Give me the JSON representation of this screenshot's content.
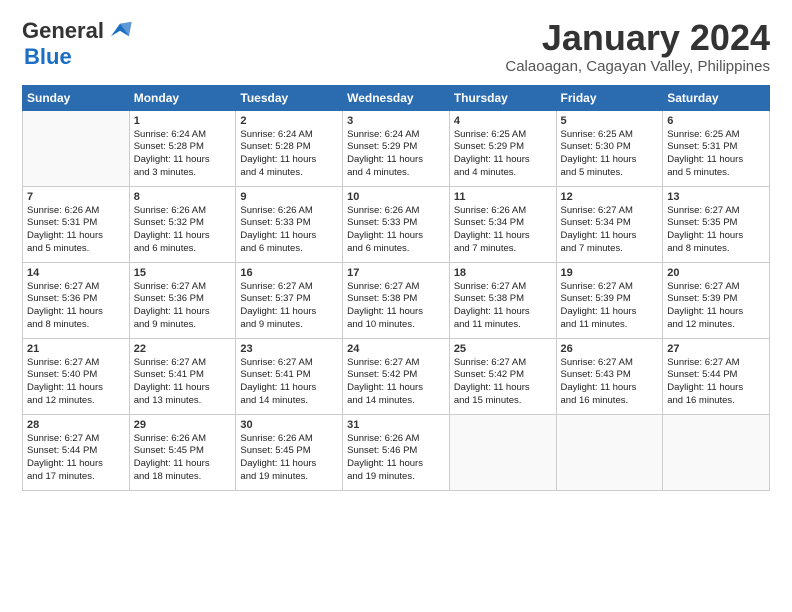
{
  "logo": {
    "general": "General",
    "blue": "Blue"
  },
  "title": "January 2024",
  "subtitle": "Calaoagan, Cagayan Valley, Philippines",
  "headers": [
    "Sunday",
    "Monday",
    "Tuesday",
    "Wednesday",
    "Thursday",
    "Friday",
    "Saturday"
  ],
  "weeks": [
    [
      {
        "day": "",
        "info": ""
      },
      {
        "day": "1",
        "info": "Sunrise: 6:24 AM\nSunset: 5:28 PM\nDaylight: 11 hours\nand 3 minutes."
      },
      {
        "day": "2",
        "info": "Sunrise: 6:24 AM\nSunset: 5:28 PM\nDaylight: 11 hours\nand 4 minutes."
      },
      {
        "day": "3",
        "info": "Sunrise: 6:24 AM\nSunset: 5:29 PM\nDaylight: 11 hours\nand 4 minutes."
      },
      {
        "day": "4",
        "info": "Sunrise: 6:25 AM\nSunset: 5:29 PM\nDaylight: 11 hours\nand 4 minutes."
      },
      {
        "day": "5",
        "info": "Sunrise: 6:25 AM\nSunset: 5:30 PM\nDaylight: 11 hours\nand 5 minutes."
      },
      {
        "day": "6",
        "info": "Sunrise: 6:25 AM\nSunset: 5:31 PM\nDaylight: 11 hours\nand 5 minutes."
      }
    ],
    [
      {
        "day": "7",
        "info": "Sunrise: 6:26 AM\nSunset: 5:31 PM\nDaylight: 11 hours\nand 5 minutes."
      },
      {
        "day": "8",
        "info": "Sunrise: 6:26 AM\nSunset: 5:32 PM\nDaylight: 11 hours\nand 6 minutes."
      },
      {
        "day": "9",
        "info": "Sunrise: 6:26 AM\nSunset: 5:33 PM\nDaylight: 11 hours\nand 6 minutes."
      },
      {
        "day": "10",
        "info": "Sunrise: 6:26 AM\nSunset: 5:33 PM\nDaylight: 11 hours\nand 6 minutes."
      },
      {
        "day": "11",
        "info": "Sunrise: 6:26 AM\nSunset: 5:34 PM\nDaylight: 11 hours\nand 7 minutes."
      },
      {
        "day": "12",
        "info": "Sunrise: 6:27 AM\nSunset: 5:34 PM\nDaylight: 11 hours\nand 7 minutes."
      },
      {
        "day": "13",
        "info": "Sunrise: 6:27 AM\nSunset: 5:35 PM\nDaylight: 11 hours\nand 8 minutes."
      }
    ],
    [
      {
        "day": "14",
        "info": "Sunrise: 6:27 AM\nSunset: 5:36 PM\nDaylight: 11 hours\nand 8 minutes."
      },
      {
        "day": "15",
        "info": "Sunrise: 6:27 AM\nSunset: 5:36 PM\nDaylight: 11 hours\nand 9 minutes."
      },
      {
        "day": "16",
        "info": "Sunrise: 6:27 AM\nSunset: 5:37 PM\nDaylight: 11 hours\nand 9 minutes."
      },
      {
        "day": "17",
        "info": "Sunrise: 6:27 AM\nSunset: 5:38 PM\nDaylight: 11 hours\nand 10 minutes."
      },
      {
        "day": "18",
        "info": "Sunrise: 6:27 AM\nSunset: 5:38 PM\nDaylight: 11 hours\nand 11 minutes."
      },
      {
        "day": "19",
        "info": "Sunrise: 6:27 AM\nSunset: 5:39 PM\nDaylight: 11 hours\nand 11 minutes."
      },
      {
        "day": "20",
        "info": "Sunrise: 6:27 AM\nSunset: 5:39 PM\nDaylight: 11 hours\nand 12 minutes."
      }
    ],
    [
      {
        "day": "21",
        "info": "Sunrise: 6:27 AM\nSunset: 5:40 PM\nDaylight: 11 hours\nand 12 minutes."
      },
      {
        "day": "22",
        "info": "Sunrise: 6:27 AM\nSunset: 5:41 PM\nDaylight: 11 hours\nand 13 minutes."
      },
      {
        "day": "23",
        "info": "Sunrise: 6:27 AM\nSunset: 5:41 PM\nDaylight: 11 hours\nand 14 minutes."
      },
      {
        "day": "24",
        "info": "Sunrise: 6:27 AM\nSunset: 5:42 PM\nDaylight: 11 hours\nand 14 minutes."
      },
      {
        "day": "25",
        "info": "Sunrise: 6:27 AM\nSunset: 5:42 PM\nDaylight: 11 hours\nand 15 minutes."
      },
      {
        "day": "26",
        "info": "Sunrise: 6:27 AM\nSunset: 5:43 PM\nDaylight: 11 hours\nand 16 minutes."
      },
      {
        "day": "27",
        "info": "Sunrise: 6:27 AM\nSunset: 5:44 PM\nDaylight: 11 hours\nand 16 minutes."
      }
    ],
    [
      {
        "day": "28",
        "info": "Sunrise: 6:27 AM\nSunset: 5:44 PM\nDaylight: 11 hours\nand 17 minutes."
      },
      {
        "day": "29",
        "info": "Sunrise: 6:26 AM\nSunset: 5:45 PM\nDaylight: 11 hours\nand 18 minutes."
      },
      {
        "day": "30",
        "info": "Sunrise: 6:26 AM\nSunset: 5:45 PM\nDaylight: 11 hours\nand 19 minutes."
      },
      {
        "day": "31",
        "info": "Sunrise: 6:26 AM\nSunset: 5:46 PM\nDaylight: 11 hours\nand 19 minutes."
      },
      {
        "day": "",
        "info": ""
      },
      {
        "day": "",
        "info": ""
      },
      {
        "day": "",
        "info": ""
      }
    ]
  ]
}
